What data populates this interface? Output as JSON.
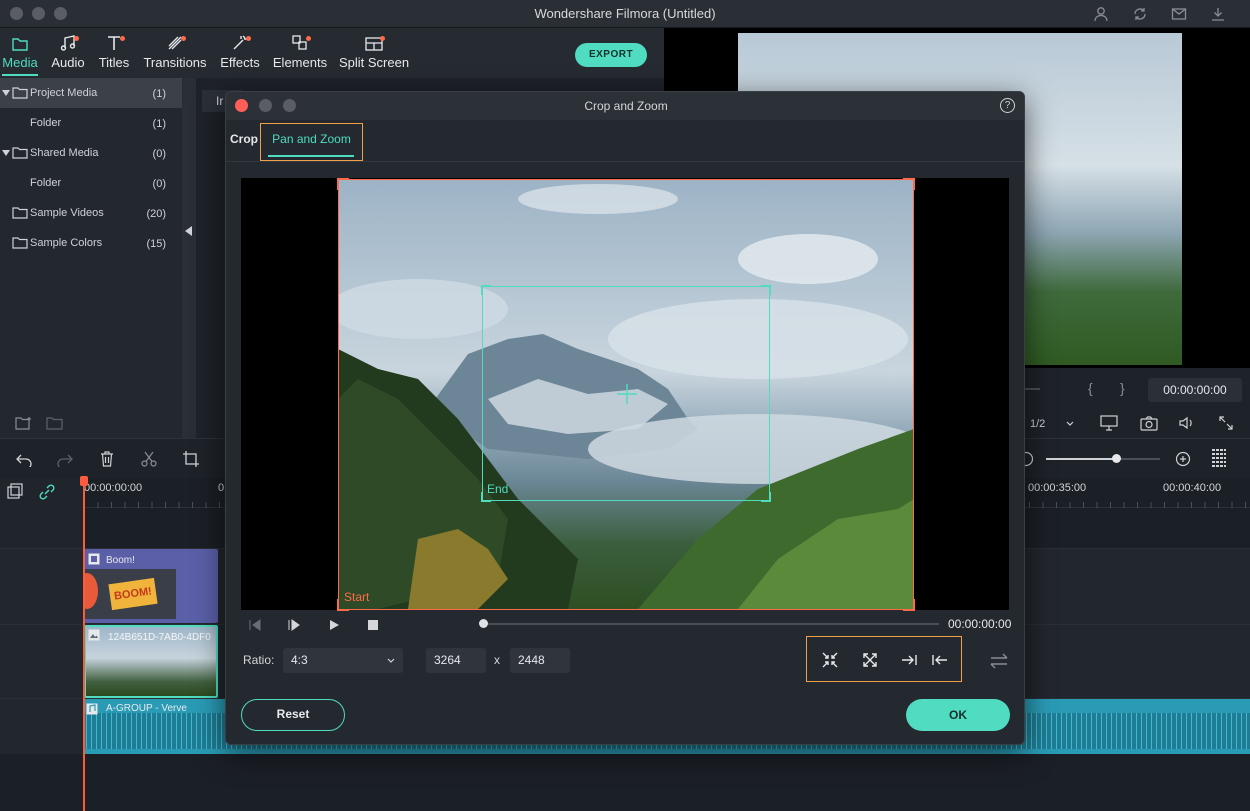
{
  "app": {
    "title": "Wondershare Filmora (Untitled)"
  },
  "toolbar": {
    "tabs": [
      {
        "label": "Media"
      },
      {
        "label": "Audio"
      },
      {
        "label": "Titles"
      },
      {
        "label": "Transitions"
      },
      {
        "label": "Effects"
      },
      {
        "label": "Elements"
      },
      {
        "label": "Split Screen"
      }
    ],
    "export_label": "EXPORT"
  },
  "library": {
    "items": [
      {
        "label": "Project Media",
        "count": "(1)"
      },
      {
        "label": "Folder",
        "count": "(1)"
      },
      {
        "label": "Shared Media",
        "count": "(0)"
      },
      {
        "label": "Folder",
        "count": "(0)"
      },
      {
        "label": "Sample Videos",
        "count": "(20)"
      },
      {
        "label": "Sample Colors",
        "count": "(15)"
      }
    ],
    "tab_hint": "Ir"
  },
  "preview": {
    "timecode": "00:00:00:00",
    "quality": "1/2",
    "brackets_open": "{",
    "brackets_close": "}"
  },
  "timeline": {
    "ruler": [
      "00:00:00:00",
      "00:00:35:00",
      "00:00:40:00"
    ],
    "ruler_partial": "0",
    "clips": {
      "title": "Boom!",
      "boom_text": "BOOM!",
      "video": "124B651D-7AB0-4DF0",
      "audio": "A-GROUP - Verve"
    }
  },
  "dialog": {
    "title": "Crop and Zoom",
    "help": "?",
    "tabs": {
      "crop": "Crop",
      "pan_zoom": "Pan and Zoom"
    },
    "labels": {
      "start": "Start",
      "end": "End"
    },
    "timecode": "00:00:00:00",
    "ratio_label": "Ratio:",
    "ratio_value": "4:3",
    "width": "3264",
    "height": "2448",
    "x_sep": "x",
    "reset_label": "Reset",
    "ok_label": "OK"
  }
}
